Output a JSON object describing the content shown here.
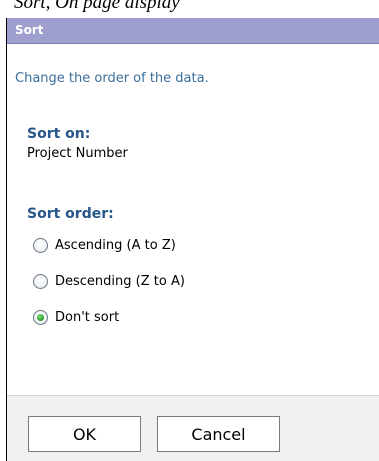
{
  "banner": {
    "text": "Sort, On page display"
  },
  "dialog": {
    "title": "Sort",
    "subtitle": "Change the order of the data.",
    "sort_on": {
      "heading": "Sort on:",
      "value": "Project Number"
    },
    "sort_order": {
      "heading": "Sort order:",
      "options": [
        {
          "label": "Ascending (A to Z)",
          "selected": false
        },
        {
          "label": "Descending (Z to A)",
          "selected": false
        },
        {
          "label": "Don't sort",
          "selected": true
        }
      ]
    },
    "buttons": {
      "ok": "OK",
      "cancel": "Cancel"
    }
  },
  "colors": {
    "titlebar": "#9e9fce",
    "heading": "#27568a",
    "subtitle": "#3c6e9c",
    "radio_selected": "#2ea32e"
  }
}
